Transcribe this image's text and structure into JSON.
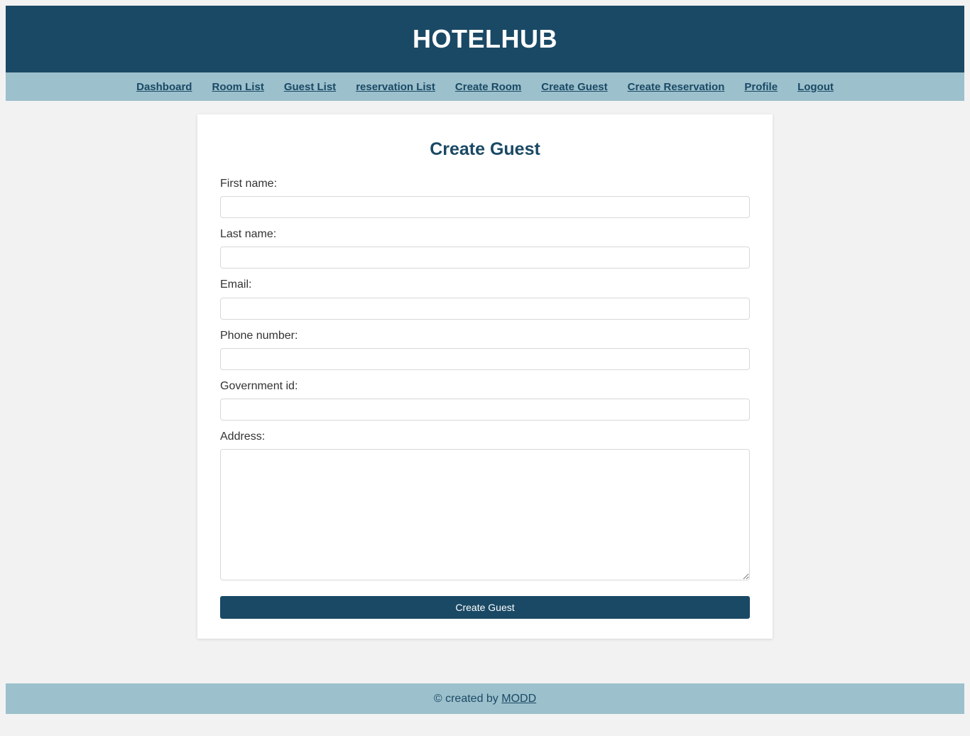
{
  "colors": {
    "header_bg": "#1a4965",
    "nav_bg": "#9cc0cc",
    "page_bg": "#f2f2f2",
    "card_bg": "#ffffff",
    "accent": "#1a4965",
    "label_text": "#333333",
    "input_border": "#d8d8d8"
  },
  "header": {
    "title": "HOTELHUB"
  },
  "nav": {
    "items": [
      {
        "label": "Dashboard",
        "name": "dashboard"
      },
      {
        "label": "Room List",
        "name": "room-list"
      },
      {
        "label": "Guest List",
        "name": "guest-list"
      },
      {
        "label": "reservation List",
        "name": "reservation-list"
      },
      {
        "label": "Create Room",
        "name": "create-room"
      },
      {
        "label": "Create Guest",
        "name": "create-guest"
      },
      {
        "label": "Create Reservation",
        "name": "create-reservation"
      },
      {
        "label": "Profile",
        "name": "profile"
      },
      {
        "label": "Logout",
        "name": "logout"
      }
    ]
  },
  "form": {
    "title": "Create Guest",
    "fields": [
      {
        "label": "First name:",
        "value": "",
        "placeholder": "",
        "type": "text",
        "name": "first-name"
      },
      {
        "label": "Last name:",
        "value": "",
        "placeholder": "",
        "type": "text",
        "name": "last-name"
      },
      {
        "label": "Email:",
        "value": "",
        "placeholder": "",
        "type": "text",
        "name": "email"
      },
      {
        "label": "Phone number:",
        "value": "",
        "placeholder": "",
        "type": "text",
        "name": "phone-number"
      },
      {
        "label": "Government id:",
        "value": "",
        "placeholder": "",
        "type": "text",
        "name": "government-id"
      }
    ],
    "address": {
      "label": "Address:",
      "value": "",
      "placeholder": ""
    },
    "submit_label": "Create Guest"
  },
  "footer": {
    "text_prefix": "© created by ",
    "link_label": "MODD"
  }
}
